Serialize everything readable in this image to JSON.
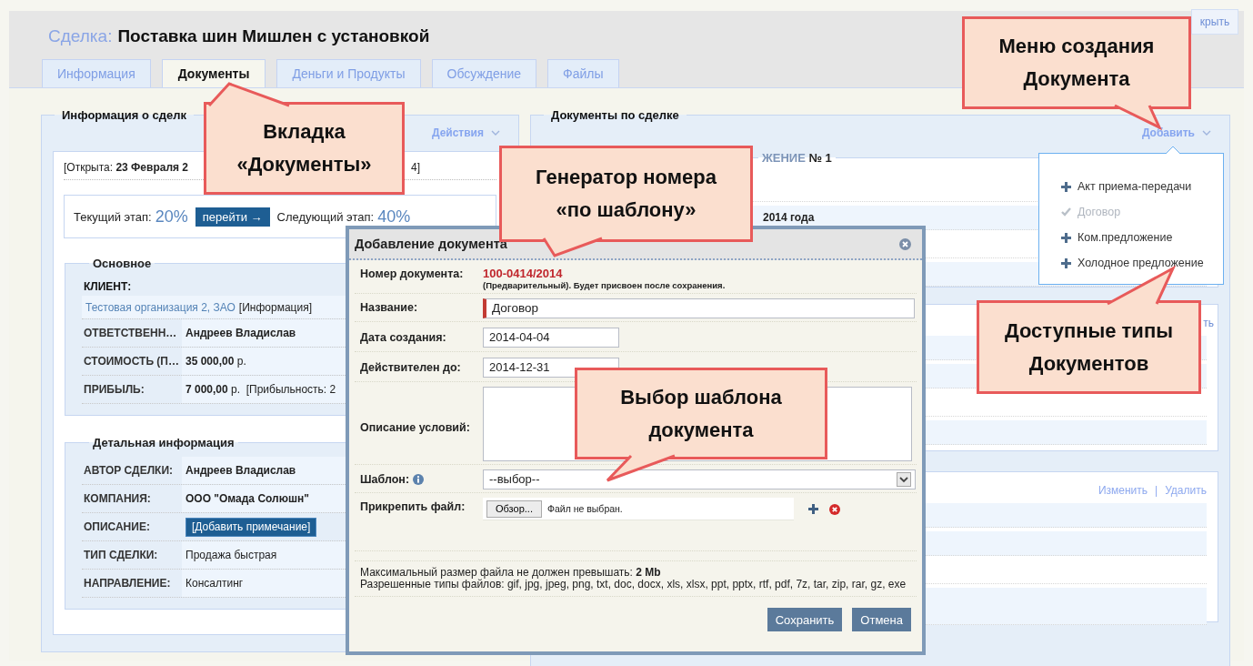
{
  "deal": {
    "label": "Сделка:",
    "title": "Поставка шин Мишлен с установкой"
  },
  "top_button": "крыть",
  "tabs": [
    {
      "label": "Информация",
      "selected": false
    },
    {
      "label": "Документы",
      "selected": true
    },
    {
      "label": "Деньги и Продукты",
      "selected": false
    },
    {
      "label": "Обсуждение",
      "selected": false
    },
    {
      "label": "Файлы",
      "selected": false
    }
  ],
  "info_panel": {
    "title": "Информация о сделк",
    "actions": "Действия",
    "opened": "[Открыта: **23 Февраля 2**",
    "opened_tail": "4]",
    "stage": {
      "current_label": "Текущий этап:",
      "current": "20%",
      "go": "перейти →",
      "next_label": "Следующий этап:",
      "next": "40%"
    },
    "sections": [
      {
        "title": "Основное",
        "rows": [
          {
            "kind": "stacked",
            "label": "КЛИЕНТ:",
            "value": "Тестовая организация 2, ЗАО",
            "extra": "[Информация]"
          },
          {
            "kind": "pair",
            "label": "ОТВЕТСТВЕНН…",
            "value": "**Андреев Владислав**"
          },
          {
            "kind": "pair",
            "label": "СТОИМОСТЬ (П…",
            "value": "**35 000,00** р."
          },
          {
            "kind": "pair",
            "label": "ПРИБЫЛЬ:",
            "value": "**7 000,00** р.  [Прибыльность: 2"
          }
        ]
      },
      {
        "title": "Детальная информация",
        "rows": [
          {
            "kind": "pair",
            "label": "АВТОР СДЕЛКИ:",
            "value": "**Андреев Владислав**"
          },
          {
            "kind": "pair",
            "label": "КОМПАНИЯ:",
            "value": "**ООО \"Омада Солюшн\"**"
          },
          {
            "kind": "button",
            "label": "ОПИСАНИЕ:",
            "value": "[Добавить примечание]"
          },
          {
            "kind": "pair",
            "label": "ТИП СДЕЛКИ:",
            "value": "Продажа быстрая"
          },
          {
            "kind": "pair",
            "label": "НАПРАВЛЕНИЕ:",
            "value": "Консалтинг"
          }
        ]
      }
    ]
  },
  "documents_panel": {
    "title": "Документы по сделке",
    "add": "Добавить",
    "card_legend": "ЖЕНИЕ",
    "card_number": "№ 1",
    "card_date": "2014 года",
    "card2_link": "ть",
    "card3_links": [
      "Изменить",
      "|",
      "Удалить"
    ]
  },
  "add_menu": [
    {
      "label": "Акт приема-передачи",
      "disabled": false
    },
    {
      "label": "Договор",
      "disabled": true
    },
    {
      "label": "Ком.предложение",
      "disabled": false
    },
    {
      "label": "Холодное предложение",
      "disabled": false
    }
  ],
  "dialog": {
    "title": "Добавление документа",
    "fields": [
      {
        "kind": "number",
        "label": "Номер документа:",
        "value": "100-0414/2014",
        "note": "(Предварительный). Будет присвоен после сохранения."
      },
      {
        "kind": "text",
        "label": "Название:",
        "value": "Договор"
      },
      {
        "kind": "date",
        "label": "Дата создания:",
        "value": "2014-04-04"
      },
      {
        "kind": "date",
        "label": "Действителен до:",
        "value": "2014-12-31"
      },
      {
        "kind": "textarea",
        "label": "Описание условий:"
      },
      {
        "kind": "select",
        "label": "Шаблон:",
        "value": "--выбор--"
      },
      {
        "kind": "file",
        "label": "Прикрепить файл:",
        "button": "Обзор...",
        "value": "Файл не выбран."
      }
    ],
    "limits": [
      "Максимальный размер файла не должен превышать: **2 Mb**",
      "Разрешенные типы файлов: gif, jpg, jpeg, png, txt, doc, docx, xls, xlsx, ppt, pptx, rtf, pdf, 7z, tar, zip, rar, gz, exe"
    ],
    "buttons": [
      "Сохранить",
      "Отмена"
    ]
  },
  "callouts": [
    {
      "lines": [
        "Вкладка",
        "«Документы»"
      ]
    },
    {
      "lines": [
        "Генератор номера",
        "«по шаблону»"
      ]
    },
    {
      "lines": [
        "Меню создания",
        "Документа"
      ]
    },
    {
      "lines": [
        "Доступные типы",
        "Документов"
      ]
    },
    {
      "lines": [
        "Выбор шаблона",
        "документа"
      ]
    }
  ]
}
